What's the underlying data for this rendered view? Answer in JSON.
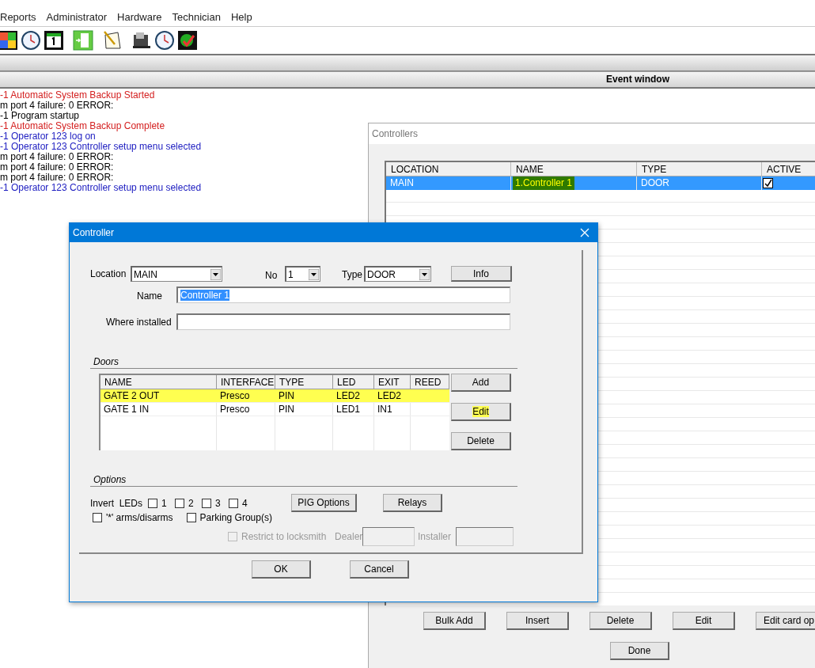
{
  "menu_bar": [
    "Reports",
    "Administrator",
    "Hardware",
    "Technician",
    "Help"
  ],
  "toolbar": [
    {
      "kind": "tiles"
    },
    {
      "kind": "clock"
    },
    {
      "kind": "calendar"
    },
    {
      "kind": "door"
    },
    {
      "kind": "notepad"
    },
    {
      "kind": "machine"
    },
    {
      "kind": "clock"
    },
    {
      "kind": "runner"
    }
  ],
  "event_window": {
    "title": "Event window",
    "lines": [
      {
        "text": "-1 Automatic System Backup Started",
        "color": "#d42020"
      },
      {
        "text": "m port 4 failure: 0 ERROR:",
        "color": "#000000"
      },
      {
        "text": "-1 Program startup",
        "color": "#000000"
      },
      {
        "text": "-1 Automatic System Backup Complete",
        "color": "#d42020"
      },
      {
        "text": "-1 Operator 123 log on",
        "color": "#1c1cc0"
      },
      {
        "text": "-1 Operator 123 Controller setup menu selected",
        "color": "#1c1cc0"
      },
      {
        "text": "m port 4 failure: 0 ERROR:",
        "color": "#000000"
      },
      {
        "text": "m port 4 failure: 0 ERROR:",
        "color": "#000000"
      },
      {
        "text": "m port 4 failure: 0 ERROR:",
        "color": "#000000"
      },
      {
        "text": "-1 Operator 123 Controller setup menu selected",
        "color": "#1c1cc0"
      }
    ]
  },
  "controllers_window": {
    "title": "Controllers",
    "columns": [
      "LOCATION",
      "NAME",
      "TYPE",
      "ACTIVE"
    ],
    "rows": [
      {
        "cells": [
          {
            "text": "MAIN",
            "highlighted": false
          },
          {
            "text": "1.Controller 1",
            "highlighted": true
          },
          {
            "text": "DOOR",
            "highlighted": false
          }
        ],
        "active": true,
        "selected": true
      }
    ],
    "buttons": [
      "Bulk Add",
      "Insert",
      "Delete",
      "Edit",
      "Edit card op"
    ],
    "done_button": "Done"
  },
  "controller_dialog": {
    "title": "Controller",
    "location": {
      "label": "Location",
      "value": "MAIN"
    },
    "number": {
      "label": "No",
      "value": "1"
    },
    "type": {
      "label": "Type",
      "value": "DOOR"
    },
    "info_button": "Info",
    "name": {
      "label": "Name",
      "value": "Controller 1",
      "selected": true
    },
    "where_installed": {
      "label": "Where installed"
    },
    "doors": {
      "title": "Doors",
      "columns": [
        "NAME",
        "INTERFACE",
        "TYPE",
        "LED",
        "EXIT",
        "REED"
      ],
      "rows": [
        {
          "cells": [
            "GATE 2 OUT",
            "Presco",
            "PIN",
            "LED2",
            "LED2"
          ],
          "highlighted": true
        },
        {
          "cells": [
            "GATE 1 IN",
            "Presco",
            "PIN",
            "LED1",
            "IN1"
          ],
          "highlighted": false
        }
      ],
      "buttons": [
        {
          "label": "Add",
          "highlighted": false
        },
        {
          "label": "Edit",
          "highlighted": true
        },
        {
          "label": "Delete",
          "highlighted": false
        }
      ]
    },
    "options": {
      "title": "Options",
      "invert_leds": {
        "label": "Invert  LEDs",
        "boxes": [
          {
            "label": "1",
            "checked": false
          },
          {
            "label": "2",
            "checked": false
          },
          {
            "label": "3",
            "checked": false
          },
          {
            "label": "4",
            "checked": false
          }
        ]
      },
      "pig_options_button": "PIG Options",
      "relays_button": "Relays",
      "checkboxes": [
        {
          "label": "'*' arms/disarms",
          "checked": false
        },
        {
          "label": "Parking Group(s)",
          "checked": false
        }
      ],
      "restrict": {
        "label": "Restrict to locksmith",
        "checked": false,
        "disabled": true
      },
      "dealer": {
        "label": "Dealer"
      },
      "installer": {
        "label": "Installer"
      }
    },
    "buttons": [
      "OK",
      "Cancel"
    ]
  }
}
